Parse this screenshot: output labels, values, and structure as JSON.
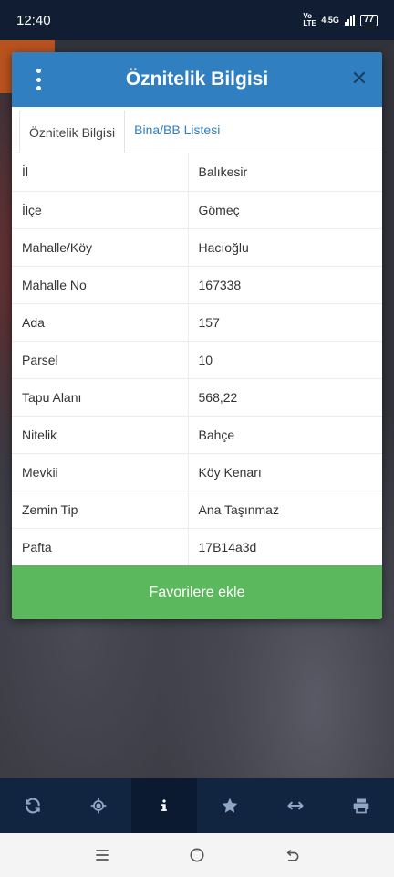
{
  "status": {
    "time": "12:40",
    "network": "4.5G",
    "volte": "Vo LTE",
    "battery": "77"
  },
  "dialog": {
    "title": "Öznitelik Bilgisi",
    "menu_icon": "kebab-menu-icon",
    "close_icon": "close-icon",
    "tabs": [
      {
        "label": "Öznitelik Bilgisi",
        "active": true
      },
      {
        "label": "Bina/BB Listesi",
        "active": false
      }
    ],
    "rows": [
      {
        "key": "İl",
        "value": "Balıkesir"
      },
      {
        "key": "İlçe",
        "value": "Gömeç"
      },
      {
        "key": "Mahalle/Köy",
        "value": "Hacıoğlu"
      },
      {
        "key": "Mahalle No",
        "value": "167338"
      },
      {
        "key": "Ada",
        "value": "157"
      },
      {
        "key": "Parsel",
        "value": "10"
      },
      {
        "key": "Tapu Alanı",
        "value": "568,22"
      },
      {
        "key": "Nitelik",
        "value": "Bahçe"
      },
      {
        "key": "Mevkii",
        "value": "Köy Kenarı"
      },
      {
        "key": "Zemin Tip",
        "value": "Ana Taşınmaz"
      },
      {
        "key": "Pafta",
        "value": "17B14a3d"
      }
    ],
    "favorite_label": "Favorilere ekle"
  },
  "toolbar": {
    "items": [
      {
        "icon": "refresh-icon"
      },
      {
        "icon": "locate-icon"
      },
      {
        "icon": "info-icon",
        "active": true
      },
      {
        "icon": "star-icon"
      },
      {
        "icon": "measure-icon"
      },
      {
        "icon": "print-icon"
      }
    ]
  },
  "colors": {
    "header": "#2f7fc1",
    "favorite": "#5cb85c",
    "toolbar": "#122540",
    "status_bar": "#111d33"
  }
}
